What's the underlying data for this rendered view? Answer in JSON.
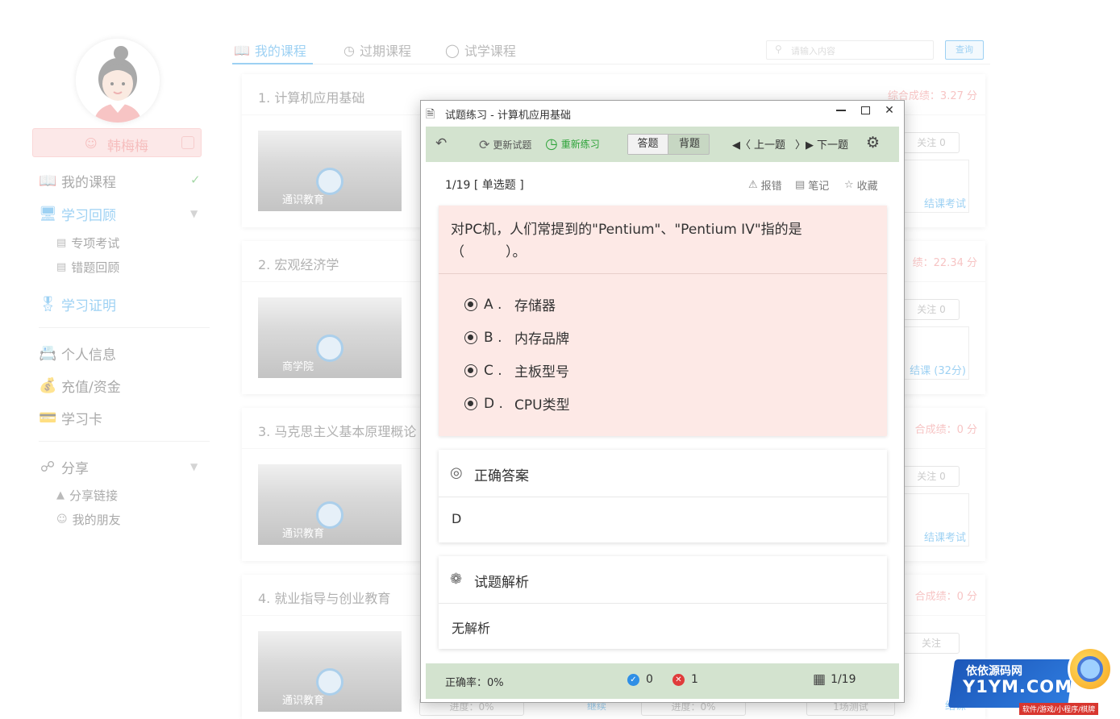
{
  "sidebar": {
    "username": "韩梅梅",
    "menu": [
      {
        "label": "我的课程",
        "icon": "book-icon"
      },
      {
        "label": "学习回顾",
        "icon": "monitor-icon"
      },
      {
        "label": "学习证明",
        "icon": "certificate-icon"
      },
      {
        "label": "个人信息",
        "icon": "id-card-icon"
      },
      {
        "label": "充值/资金",
        "icon": "money-bag-icon"
      },
      {
        "label": "学习卡",
        "icon": "card-icon"
      },
      {
        "label": "分享",
        "icon": "share-icon"
      }
    ],
    "review_sub": [
      "专项考试",
      "错题回顾"
    ],
    "share_sub": [
      "分享链接",
      "我的朋友"
    ]
  },
  "tabs": {
    "items": [
      "我的课程",
      "过期课程",
      "试学课程"
    ],
    "search_placeholder": "请输入内容",
    "search_button": "查询"
  },
  "courses": [
    {
      "title": "1. 计算机应用基础",
      "score": "综合成绩：3.27 分",
      "thumb_label": "通识教育",
      "follow": "关注 0",
      "exam": "结课考试"
    },
    {
      "title": "2. 宏观经济学",
      "score": "绩：22.34 分",
      "thumb_label": "商学院",
      "follow": "关注 0",
      "exam": "结课 (32分)"
    },
    {
      "title": "3. 马克思主义基本原理概论",
      "score": "合成绩：0 分",
      "thumb_label": "通识教育",
      "follow": "关注 0",
      "exam": "结课考试"
    },
    {
      "title": "4. 就业指导与创业教育",
      "score": "合成绩：0 分",
      "thumb_label": "通识教育",
      "follow": "关注",
      "exam": "结课"
    }
  ],
  "bottom_row": [
    "进度：0%",
    "继续",
    "进度：0%",
    "1场测试"
  ],
  "dialog": {
    "title": "试题练习 - 计算机应用基础",
    "toolbar": {
      "refresh": "更新试题",
      "redo": "重新练习",
      "mode_answer": "答题",
      "mode_memorize": "背题",
      "prev": "上一题",
      "next": "下一题"
    },
    "question": {
      "meta": "1/19 [ 单选题 ]",
      "report": "报错",
      "note": "笔记",
      "favorite": "收藏",
      "text": "对PC机，人们常提到的\"Pentium\"、\"Pentium IV\"指的是（　　　）。",
      "options": [
        {
          "letter": "A .",
          "text": "存储器"
        },
        {
          "letter": "B .",
          "text": "内存品牌"
        },
        {
          "letter": "C .",
          "text": "主板型号"
        },
        {
          "letter": "D .",
          "text": "CPU类型"
        }
      ]
    },
    "answer": {
      "title": "正确答案",
      "value": "D"
    },
    "analysis": {
      "title": "试题解析",
      "value": "无解析"
    },
    "status": {
      "rate": "正确率：0%",
      "correct": "0",
      "wrong": "1",
      "page": "1/19"
    }
  },
  "watermark": {
    "line1": "依依源码网",
    "line2": "Y1YM.COM",
    "line3": "软件/游戏/小程序/棋牌"
  },
  "colors": {
    "accent": "#3ea5e9",
    "toolbar_bg": "#d3e3cf",
    "question_bg": "#fde9e6",
    "redo_green": "#2ea33a"
  }
}
